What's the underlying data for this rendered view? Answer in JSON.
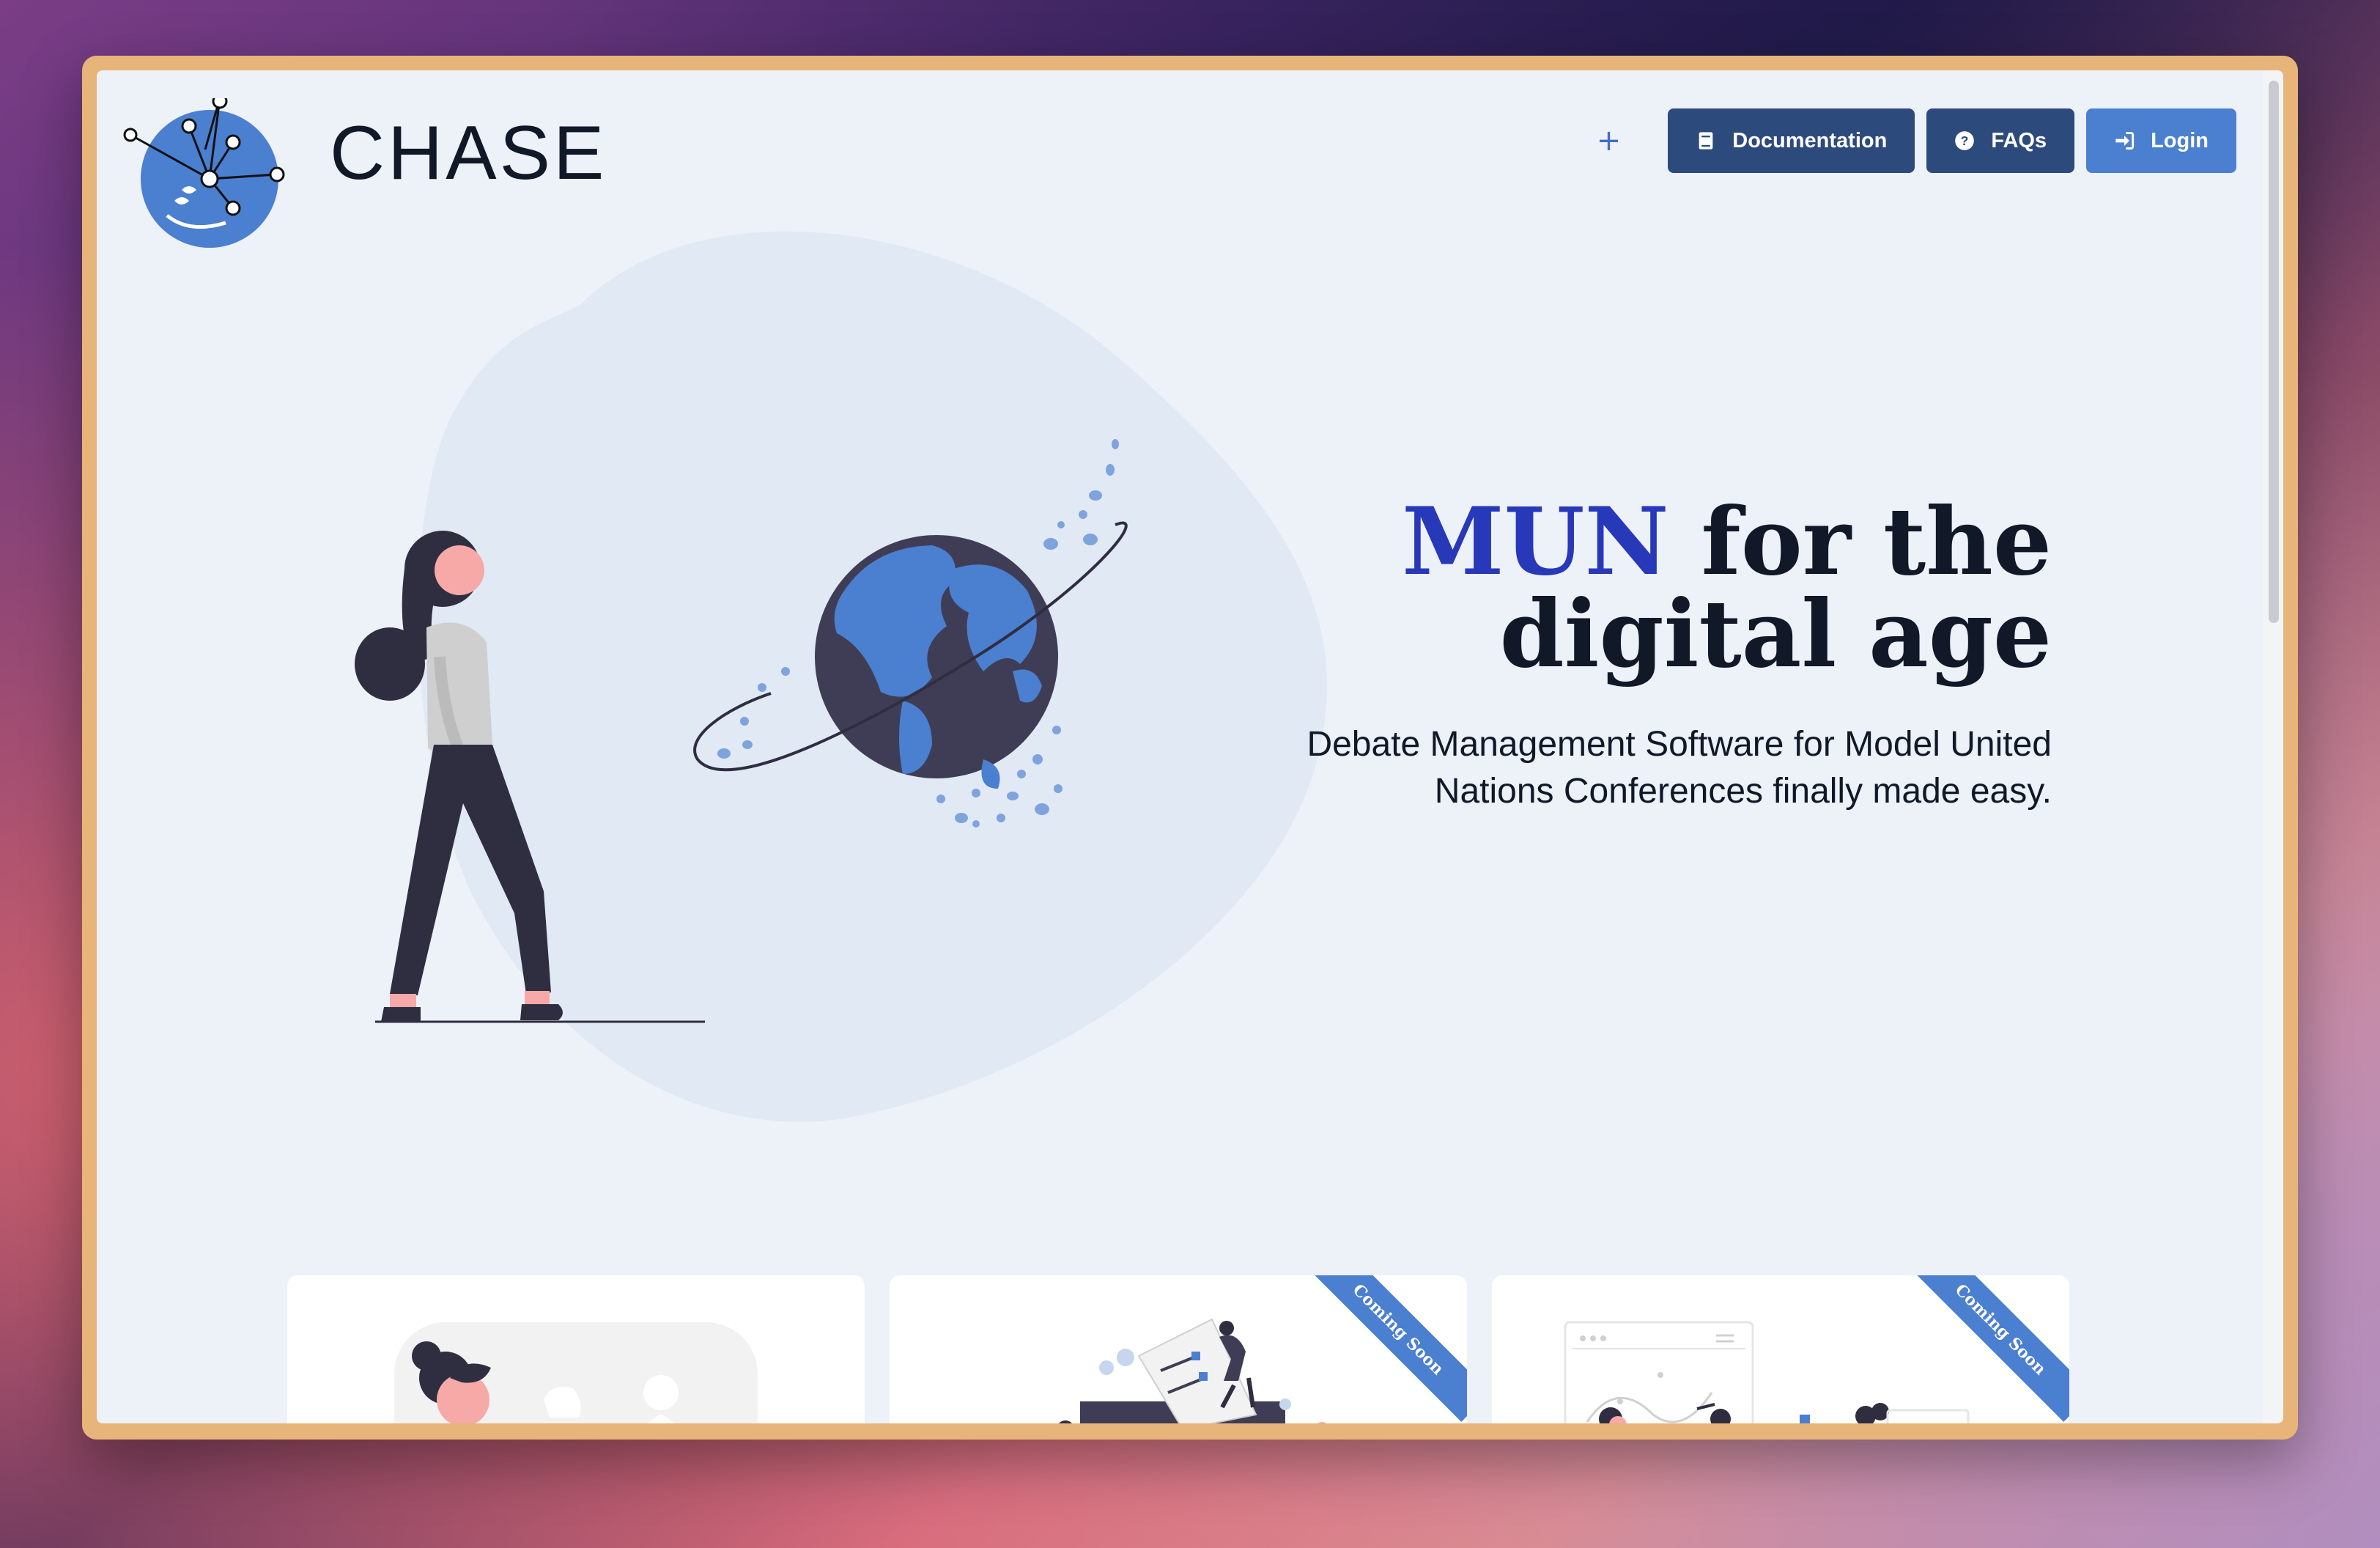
{
  "brand": {
    "name": "CHASE"
  },
  "nav": {
    "plus_label": "+",
    "documentation_label": "Documentation",
    "faqs_label": "FAQs",
    "login_label": "Login"
  },
  "hero": {
    "title_accent": "MUN",
    "title_rest": "for the digital age",
    "subtitle": "Debate Management Software for Model United Nations Conferences finally made easy."
  },
  "cards": [
    {
      "badge": ""
    },
    {
      "badge": "Coming Soon"
    },
    {
      "badge": "Coming Soon"
    }
  ],
  "colors": {
    "accent": "#4b7fd0",
    "dark_button": "#2d4a7c",
    "title_accent": "#2738b8",
    "page_bg": "#edf1f8",
    "frame": "#e7b47a"
  },
  "icons": [
    "logo-network-icon",
    "plus-icon",
    "book-icon",
    "question-icon",
    "login-icon"
  ]
}
